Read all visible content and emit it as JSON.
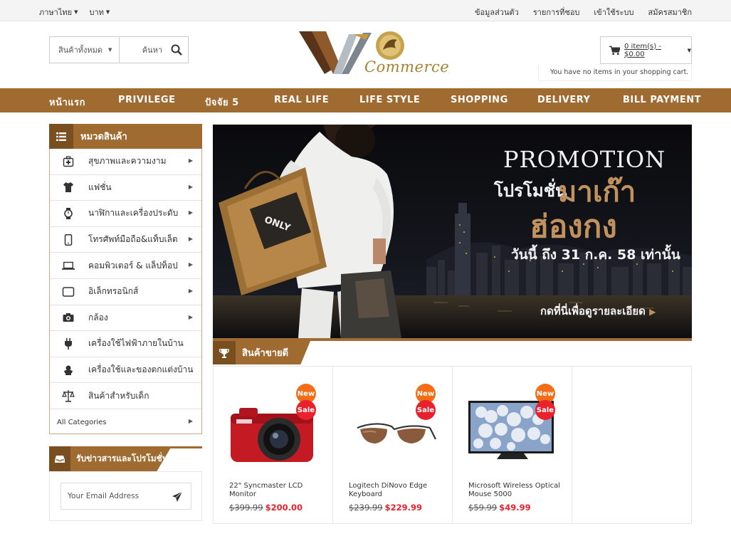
{
  "topbar": {
    "language": "ภาษาไทย",
    "currency": "บาท",
    "links": [
      "ข้อมูลส่วนตัว",
      "รายการที่ชอบ",
      "เข้าใช้ระบบ",
      "สมัครสมาชิก"
    ]
  },
  "search": {
    "category": "สินค้าทั้งหมด",
    "placeholder": "ค้นหา"
  },
  "logo": {
    "text": "Commerce"
  },
  "cart": {
    "summary": "0 item(s) - $0.00",
    "note": "You have no items in your shopping cart."
  },
  "nav": {
    "items": [
      "หน้าแรก",
      "PRIVILEGE",
      "ปัจจัย 5",
      "REAL LIFE",
      "LIFE STYLE",
      "SHOPPING",
      "DELIVERY",
      "BILL PAYMENT"
    ]
  },
  "categories": {
    "title": "หมวดสินค้า",
    "items": [
      {
        "label": "สุขภาพและความงาม",
        "icon": "medkit-icon",
        "has_sub": true
      },
      {
        "label": "แฟชั่น",
        "icon": "shirt-icon",
        "has_sub": true
      },
      {
        "label": "นาฬิกาและเครื่องประดับ",
        "icon": "watch-icon",
        "has_sub": true
      },
      {
        "label": "โทรศัพท์มือถือ&แท็บเล็ต",
        "icon": "mobile-icon",
        "has_sub": true
      },
      {
        "label": "คอมพิวเตอร์ & แล็ปท็อป",
        "icon": "laptop-icon",
        "has_sub": true
      },
      {
        "label": "อิเล็กทรอนิกส์",
        "icon": "tablet-icon",
        "has_sub": true
      },
      {
        "label": "กล้อง",
        "icon": "camera-icon",
        "has_sub": true
      },
      {
        "label": "เครื่องใช้ไฟฟ้าภายในบ้าน",
        "icon": "plug-icon",
        "has_sub": false
      },
      {
        "label": "เครื่องใช้และของตกแต่งบ้าน",
        "icon": "decor-icon",
        "has_sub": false
      },
      {
        "label": "สินค้าสำหรับเด็ก",
        "icon": "baby-icon",
        "has_sub": false
      }
    ],
    "all_label": "All Categories"
  },
  "newsletter": {
    "title": "รับข่าวสารและโปรโมชั่น",
    "placeholder": "Your Email Address"
  },
  "banner": {
    "title_en": "PROMOTION",
    "title_th1": "โปรโมชั่น",
    "title_th2": "มาเก๊า",
    "title_th3": "ฮ่องกง",
    "date": "วันนี้ ถึง 31 ก.ค. 58 เท่านั้น",
    "cta": "กดที่นี่เพื่อดูรายละเอียด",
    "bag_text": "ONLY"
  },
  "bestseller": {
    "title": "สินค้าขายดี",
    "badge_new": "New",
    "badge_sale": "Sale",
    "products": [
      {
        "name": "22\" Syncmaster LCD Monitor",
        "old_price": "$399.99",
        "new_price": "$200.00",
        "image": "camera"
      },
      {
        "name": "Logitech DiNovo Edge Keyboard",
        "old_price": "$239.99",
        "new_price": "$229.99",
        "image": "sunglasses"
      },
      {
        "name": "Microsoft Wireless Optical Mouse 5000",
        "old_price": "$59.99",
        "new_price": "$49.99",
        "image": "tv"
      }
    ]
  },
  "colors": {
    "brand": "#9f6b30",
    "brand_dark": "#7a4f1f",
    "sale": "#e8212d",
    "new": "#f36d16"
  }
}
